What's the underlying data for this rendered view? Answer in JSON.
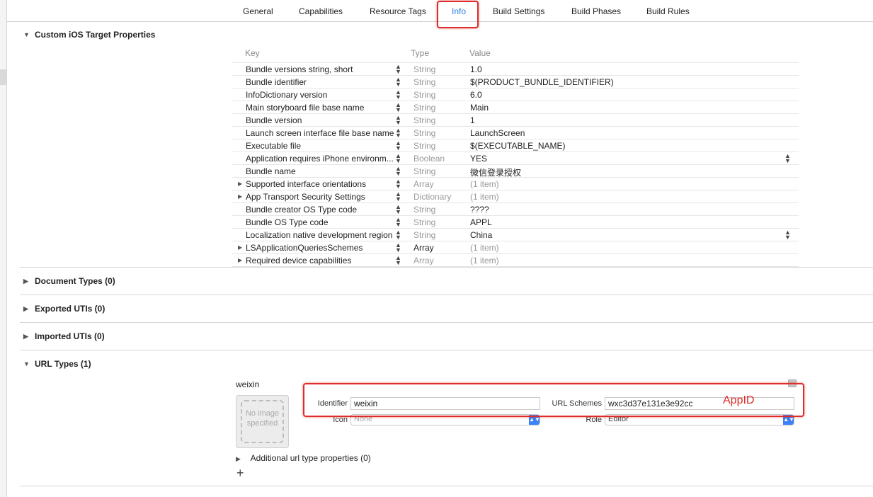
{
  "tabs": [
    "General",
    "Capabilities",
    "Resource Tags",
    "Info",
    "Build Settings",
    "Build Phases",
    "Build Rules"
  ],
  "active_tab": "Info",
  "custom_props": {
    "title": "Custom iOS Target Properties",
    "headers": {
      "key": "Key",
      "type": "Type",
      "value": "Value"
    },
    "rows": [
      {
        "key": "Bundle versions string, short",
        "type": "String",
        "value": "1.0"
      },
      {
        "key": "Bundle identifier",
        "type": "String",
        "value": "$(PRODUCT_BUNDLE_IDENTIFIER)"
      },
      {
        "key": "InfoDictionary version",
        "type": "String",
        "value": "6.0"
      },
      {
        "key": "Main storyboard file base name",
        "type": "String",
        "value": "Main"
      },
      {
        "key": "Bundle version",
        "type": "String",
        "value": "1"
      },
      {
        "key": "Launch screen interface file base name",
        "type": "String",
        "value": "LaunchScreen"
      },
      {
        "key": "Executable file",
        "type": "String",
        "value": "$(EXECUTABLE_NAME)"
      },
      {
        "key": "Application requires iPhone environm...",
        "type": "Boolean",
        "value": "YES"
      },
      {
        "key": "Bundle name",
        "type": "String",
        "value": "微信登录授权"
      },
      {
        "key": "Supported interface orientations",
        "type": "Array",
        "value": "(1 item)"
      },
      {
        "key": "App Transport Security Settings",
        "type": "Dictionary",
        "value": "(1 item)"
      },
      {
        "key": "Bundle creator OS Type code",
        "type": "String",
        "value": "????"
      },
      {
        "key": "Bundle OS Type code",
        "type": "String",
        "value": "APPL"
      },
      {
        "key": "Localization native development region",
        "type": "String",
        "value": "China"
      },
      {
        "key": "LSApplicationQueriesSchemes",
        "type": "Array",
        "value": "(1 item)"
      },
      {
        "key": "Required device capabilities",
        "type": "Array",
        "value": "(1 item)"
      }
    ]
  },
  "sections": {
    "document_types": "Document Types (0)",
    "exported_utis": "Exported UTIs (0)",
    "imported_utis": "Imported UTIs (0)",
    "url_types": "URL Types (1)"
  },
  "url_type": {
    "name": "weixin",
    "image_placeholder": "No image specified",
    "identifier_label": "Identifier",
    "identifier_value": "weixin",
    "icon_label": "Icon",
    "icon_placeholder": "None",
    "url_schemes_label": "URL Schemes",
    "url_schemes_value": "wxc3d37e131e3e92cc",
    "role_label": "Role",
    "role_value": "Editor",
    "additional_props": "Additional url type properties (0)",
    "annotation": "AppID"
  }
}
